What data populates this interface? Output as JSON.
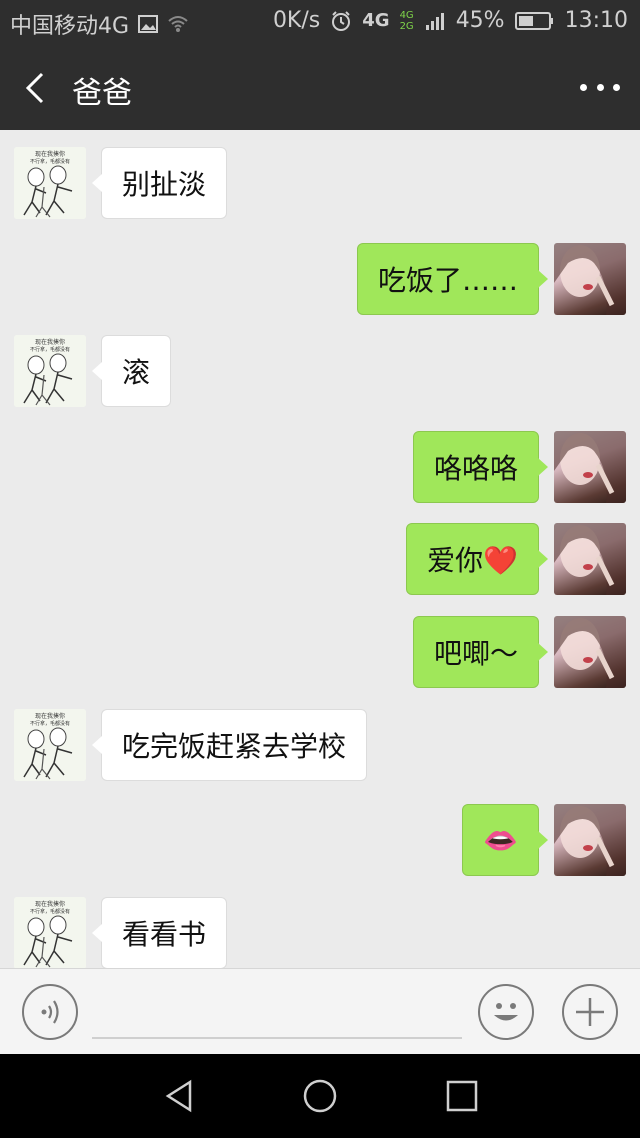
{
  "status_bar": {
    "carrier": "中国移动4G",
    "net_speed": "0K/s",
    "network": "4G",
    "network_small_top": "4G",
    "network_small_bottom": "2G",
    "battery": "45%",
    "time": "13:10"
  },
  "header": {
    "title": "爸爸"
  },
  "messages": [
    {
      "side": "left",
      "text": "别扯淡"
    },
    {
      "side": "right",
      "text": "吃饭了……"
    },
    {
      "side": "left",
      "text": "滚"
    },
    {
      "side": "right",
      "text": "咯咯咯"
    },
    {
      "side": "right",
      "text": "爱你❤️"
    },
    {
      "side": "right",
      "text": "吧唧～"
    },
    {
      "side": "left",
      "text": "吃完饭赶紧去学校"
    },
    {
      "side": "right",
      "text": "👄"
    },
    {
      "side": "left",
      "text": "看看书"
    }
  ],
  "meme_avatar_caption": {
    "line1": "现在我揍你",
    "line2": "不行拿，毛都没有"
  },
  "input": {
    "value": "",
    "placeholder": ""
  },
  "colors": {
    "bar_bg": "#2e2e2e",
    "chat_bg": "#ebebeb",
    "own_bubble": "#a0e75a",
    "other_bubble": "#ffffff"
  }
}
